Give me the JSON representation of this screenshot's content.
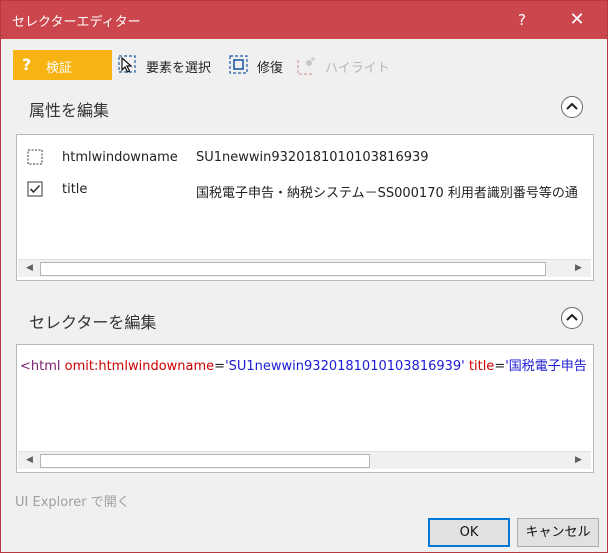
{
  "window": {
    "title": "セレクターエディター",
    "help": "?",
    "close": "✕"
  },
  "toolbar": {
    "validate_icon": "?",
    "validate_label": "検証",
    "select_label": "要素を選択",
    "repair_label": "修復",
    "highlight_label": "ハイライト"
  },
  "attributes": {
    "title": "属性を編集",
    "rows": [
      {
        "checked": false,
        "name": "htmlwindowname",
        "value": "SU1newwin9320181010103816939"
      },
      {
        "checked": true,
        "name": "title",
        "value": "国税電子申告・納税システム－SS000170 利用者識別番号等の通"
      }
    ]
  },
  "selector": {
    "title": "セレクターを編集",
    "tag_open": "<html ",
    "attr1_name": "omit:htmlwindowname",
    "eq": "=",
    "attr1_value": "'SU1newwin9320181010103816939'",
    "space": " ",
    "attr2_name": "title",
    "attr2_value": "'国税電子申告"
  },
  "footer": {
    "explorer_link": "UI Explorer で開く",
    "ok_label": "OK",
    "cancel_label": "キャンセル"
  },
  "colors": {
    "titlebar": "#cc474d",
    "validate": "#f6b312",
    "accent": "#0078d7"
  }
}
